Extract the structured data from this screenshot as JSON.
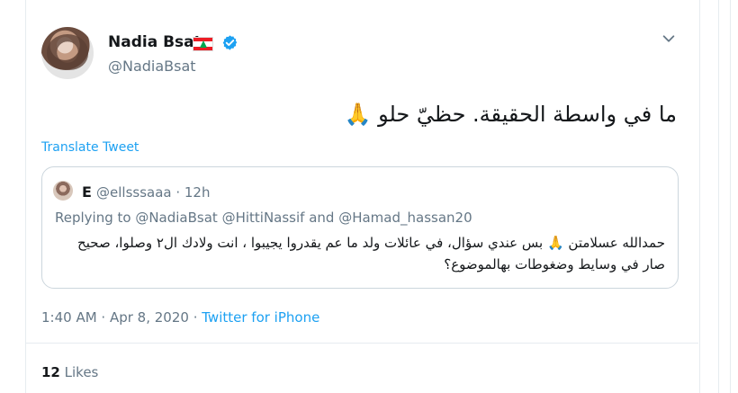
{
  "tweet": {
    "author": {
      "display_name": "Nadia Bsat",
      "handle": "@NadiaBsat"
    },
    "text": "ما في واسطة الحقيقة. حظيّ حلو 🙏",
    "translate_label": "Translate Tweet",
    "quoted": {
      "name": "E",
      "handle_time": "@ellsssaaa · 12h",
      "reply_line": "Replying to @NadiaBsat @HittiNassif and @Hamad_hassan20",
      "text_line1": "حمدالله عسلامتن 🙏 بس عندي سؤال، في عائلات ولد ما عم يقدروا يجيبوا ، انت ولادك ال٢ وصلوا، صحيح",
      "text_line2": "صار في وسايط وضغوطات بهالموضوع؟"
    },
    "timestamp": "1:40 AM · Apr 8, 2020 · ",
    "source": "Twitter for iPhone",
    "likes": {
      "count": "12",
      "label": " Likes"
    }
  },
  "colors": {
    "accent": "#1da1f2",
    "muted": "#657786",
    "text": "#14171a",
    "border": "#e6ecf0"
  },
  "icons": {
    "verified": "verified-badge-icon",
    "menu": "chevron-down-icon",
    "flag": "lebanon-flag-icon"
  }
}
